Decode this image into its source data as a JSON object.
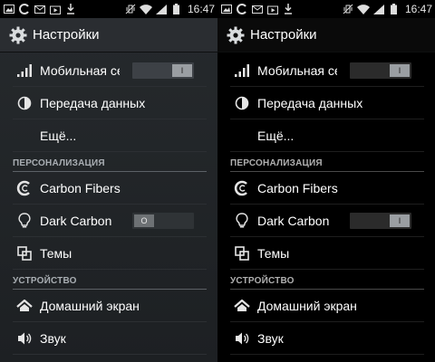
{
  "status_bar": {
    "time": "16:47"
  },
  "screens": [
    {
      "action_bar_title": "Настройки",
      "items": {
        "mobile": "Мобильная сеть",
        "data": "Передача данных",
        "more": "Ещё...",
        "carbon_fibers": "Carbon Fibers",
        "dark_carbon": "Dark Carbon",
        "themes": "Темы",
        "home": "Домашний экран",
        "sound": "Звук"
      },
      "sections": {
        "personalization": "ПЕРСОНАЛИЗАЦИЯ",
        "device": "УСТРОЙСТВО"
      },
      "toggles": {
        "mobile": "I",
        "dark_carbon": "O"
      }
    },
    {
      "action_bar_title": "Настройки",
      "items": {
        "mobile": "Мобильная сеть",
        "data": "Передача данных",
        "more": "Ещё...",
        "carbon_fibers": "Carbon Fibers",
        "dark_carbon": "Dark Carbon",
        "themes": "Темы",
        "home": "Домашний экран",
        "sound": "Звук"
      },
      "sections": {
        "personalization": "ПЕРСОНАЛИЗАЦИЯ",
        "device": "УСТРОЙСТВО"
      },
      "toggles": {
        "mobile": "I",
        "dark_carbon": "I"
      }
    }
  ],
  "icons": {
    "statusbar_left": [
      "gallery-icon",
      "sync-icon",
      "email-icon",
      "play-store-icon",
      "download-icon"
    ],
    "statusbar_right": [
      "vibrate-icon",
      "wifi-icon",
      "signal-icon",
      "battery-icon"
    ]
  },
  "colors": {
    "left_bg": "#23272a",
    "right_bg": "#000000",
    "divider": "#5c6166",
    "section_text": "#a9aeb3"
  }
}
